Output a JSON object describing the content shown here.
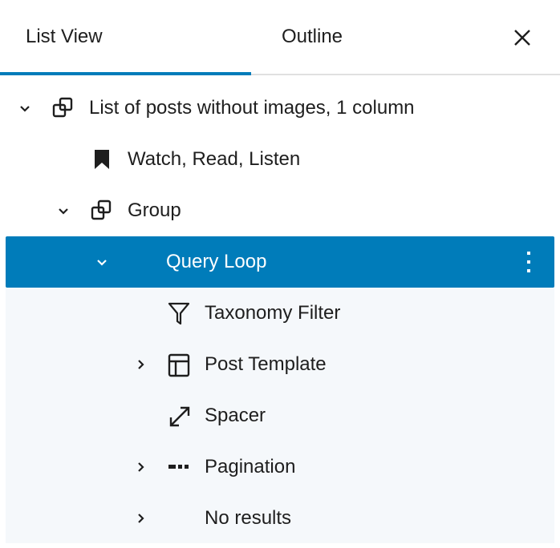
{
  "tabs": {
    "list_view": "List View",
    "outline": "Outline",
    "active": "list_view"
  },
  "close_icon": "close-icon",
  "accent_color": "#007cba",
  "tree": [
    {
      "label": "List of posts without images, 1 column",
      "icon": "group-icon",
      "level": 0,
      "expander": "expanded"
    },
    {
      "label": "Watch, Read, Listen",
      "icon": "bookmark-icon",
      "level": 1,
      "expander": "none"
    },
    {
      "label": "Group",
      "icon": "group-icon",
      "level": 1,
      "expander": "expanded"
    },
    {
      "label": "Query Loop",
      "icon": "loop-icon",
      "level": 2,
      "expander": "expanded",
      "selected": true
    },
    {
      "label": "Taxonomy Filter",
      "icon": "filter-icon",
      "level": 3,
      "expander": "none"
    },
    {
      "label": "Post Template",
      "icon": "layout-icon",
      "level": 3,
      "expander": "collapsed"
    },
    {
      "label": "Spacer",
      "icon": "resize-icon",
      "level": 3,
      "expander": "none"
    },
    {
      "label": "Pagination",
      "icon": "pagination-icon",
      "level": 3,
      "expander": "collapsed"
    },
    {
      "label": "No results",
      "icon": "loop-icon",
      "level": 3,
      "expander": "collapsed"
    }
  ]
}
